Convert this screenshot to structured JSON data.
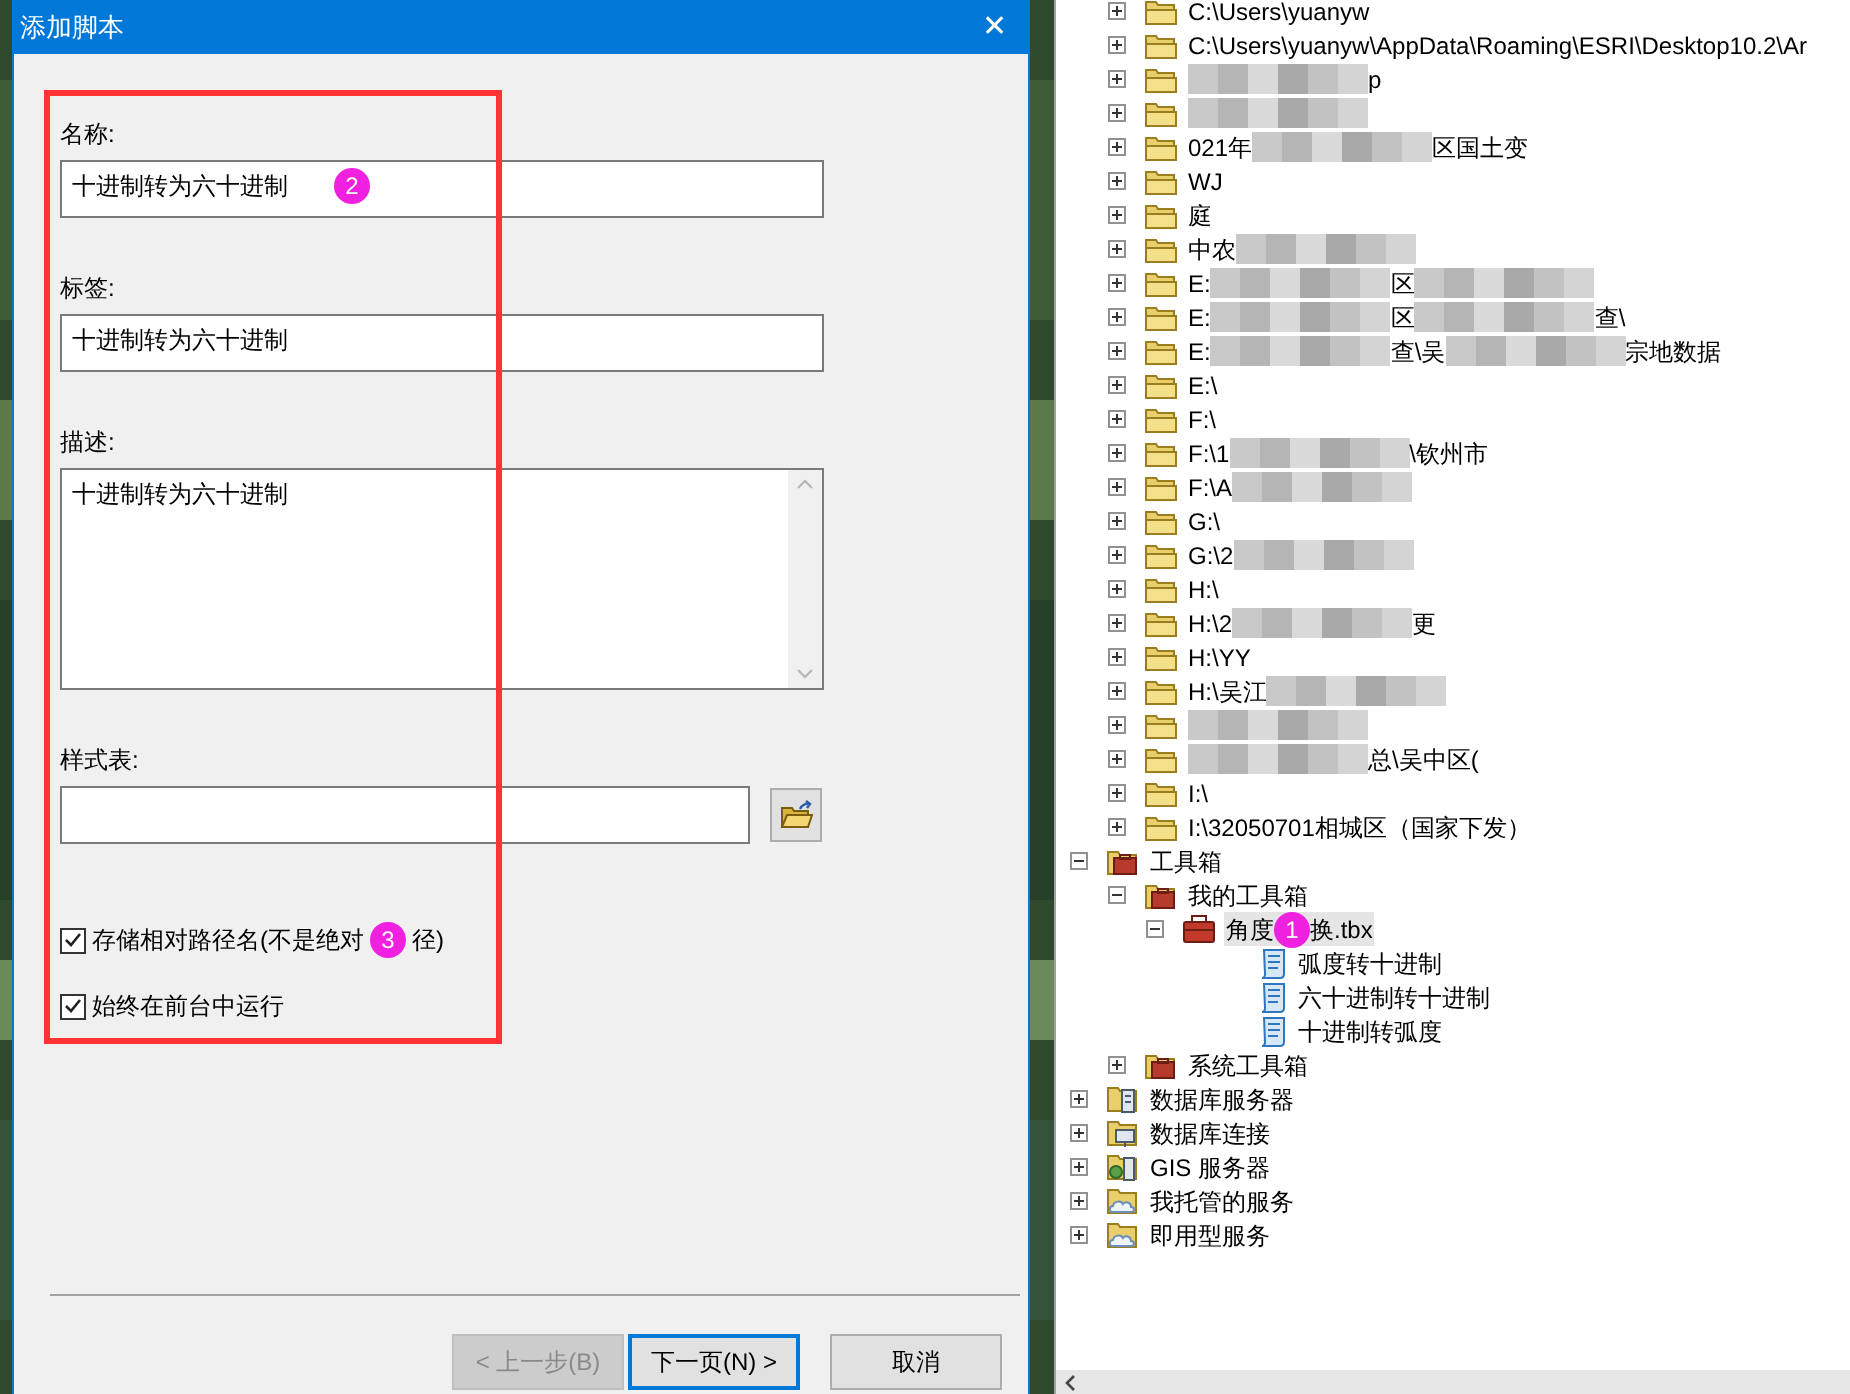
{
  "dialog": {
    "title": "添加脚本",
    "close": "✕",
    "fields": [
      {
        "label": "名称:",
        "value": "十进制转为六十进制",
        "kind": "text"
      },
      {
        "label": "标签:",
        "value": "十进制转为六十进制",
        "kind": "text"
      },
      {
        "label": "描述:",
        "value": "十进制转为六十进制",
        "kind": "multiline"
      },
      {
        "label": "样式表:",
        "kind": "browse"
      }
    ],
    "checkboxes": [
      {
        "segments": [
          {
            "kind": "text",
            "text": "存储相对路径名(不是绝对"
          },
          {
            "kind": "badge",
            "text": "3"
          },
          {
            "kind": "text",
            "text": "径)"
          }
        ],
        "checked": true
      },
      {
        "segments": [
          {
            "kind": "text",
            "text": "始终在前台中运行"
          }
        ],
        "checked": true
      }
    ],
    "buttons": [
      {
        "label": "< 上一步(B)",
        "disabled": true,
        "default": false
      },
      {
        "label": "下一页(N) >",
        "disabled": false,
        "default": true
      },
      {
        "label": "取消",
        "disabled": false,
        "default": false
      }
    ],
    "badge": "2"
  },
  "folder_connections": [
    {
      "segments": [
        {
          "kind": "text",
          "text": "C:\\Users\\yuanyw"
        }
      ]
    },
    {
      "segments": [
        {
          "kind": "text",
          "text": "C:\\Users\\yuanyw\\AppData\\Roaming\\ESRI\\Desktop10.2\\Ar"
        }
      ]
    },
    {
      "segments": [
        {
          "kind": "mosaic"
        },
        {
          "kind": "text",
          "text": "p"
        }
      ]
    },
    {
      "segments": [
        {
          "kind": "mosaic"
        }
      ]
    },
    {
      "segments": [
        {
          "kind": "text",
          "text": "021年"
        },
        {
          "kind": "mosaic"
        },
        {
          "kind": "text",
          "text": "区国土变"
        }
      ]
    },
    {
      "segments": [
        {
          "kind": "text",
          "text": "WJ"
        }
      ]
    },
    {
      "segments": [
        {
          "kind": "text",
          "text": "庭"
        }
      ]
    },
    {
      "segments": [
        {
          "kind": "text",
          "text": "中农"
        },
        {
          "kind": "mosaic"
        }
      ]
    },
    {
      "segments": [
        {
          "kind": "text",
          "text": "E:"
        },
        {
          "kind": "mosaic"
        },
        {
          "kind": "text",
          "text": "区"
        },
        {
          "kind": "mosaic"
        }
      ]
    },
    {
      "segments": [
        {
          "kind": "text",
          "text": "E:"
        },
        {
          "kind": "mosaic"
        },
        {
          "kind": "text",
          "text": "区"
        },
        {
          "kind": "mosaic"
        },
        {
          "kind": "text",
          "text": "查\\"
        }
      ]
    },
    {
      "segments": [
        {
          "kind": "text",
          "text": "E:"
        },
        {
          "kind": "mosaic"
        },
        {
          "kind": "text",
          "text": "查\\吴"
        },
        {
          "kind": "mosaic"
        },
        {
          "kind": "text",
          "text": "宗地数据"
        }
      ]
    },
    {
      "segments": [
        {
          "kind": "text",
          "text": "E:\\"
        }
      ]
    },
    {
      "segments": [
        {
          "kind": "text",
          "text": "F:\\"
        }
      ]
    },
    {
      "segments": [
        {
          "kind": "text",
          "text": "F:\\1"
        },
        {
          "kind": "mosaic"
        },
        {
          "kind": "text",
          "text": "\\钦州市"
        }
      ]
    },
    {
      "segments": [
        {
          "kind": "text",
          "text": "F:\\A"
        },
        {
          "kind": "mosaic"
        }
      ]
    },
    {
      "segments": [
        {
          "kind": "text",
          "text": "G:\\"
        }
      ]
    },
    {
      "segments": [
        {
          "kind": "text",
          "text": "G:\\2"
        },
        {
          "kind": "mosaic"
        }
      ]
    },
    {
      "segments": [
        {
          "kind": "text",
          "text": "H:\\"
        }
      ]
    },
    {
      "segments": [
        {
          "kind": "text",
          "text": "H:\\2"
        },
        {
          "kind": "mosaic"
        },
        {
          "kind": "text",
          "text": "更"
        }
      ]
    },
    {
      "segments": [
        {
          "kind": "text",
          "text": "H:\\YY"
        }
      ]
    },
    {
      "segments": [
        {
          "kind": "text",
          "text": "H:\\吴江"
        },
        {
          "kind": "mosaic"
        }
      ]
    },
    {
      "segments": [
        {
          "kind": "mosaic"
        }
      ]
    },
    {
      "segments": [
        {
          "kind": "mosaic"
        },
        {
          "kind": "text",
          "text": "总\\吴中区("
        }
      ]
    },
    {
      "segments": [
        {
          "kind": "text",
          "text": "I:\\"
        }
      ]
    },
    {
      "segments": [
        {
          "kind": "text",
          "text": "I:\\32050701相城区（国家下发）"
        }
      ]
    }
  ],
  "catalog": [
    {
      "kind": "toolbox-folder",
      "segments": [
        {
          "kind": "text",
          "text": "工具箱"
        }
      ],
      "expanded": true,
      "selected": false,
      "children": [
        {
          "kind": "toolbox-folder",
          "segments": [
            {
              "kind": "text",
              "text": "我的工具箱"
            }
          ],
          "expanded": true,
          "selected": false,
          "children": [
            {
              "kind": "toolbox",
              "segments": [
                {
                  "kind": "text",
                  "text": "角度"
                },
                {
                  "kind": "badge",
                  "text": "1"
                },
                {
                  "kind": "text",
                  "text": "换.tbx"
                }
              ],
              "expanded": true,
              "selected": true,
              "children": [
                {
                  "kind": "script",
                  "segments": [
                    {
                      "kind": "text",
                      "text": "弧度转十进制"
                    }
                  ],
                  "selected": false
                },
                {
                  "kind": "script",
                  "segments": [
                    {
                      "kind": "text",
                      "text": "六十进制转十进制"
                    }
                  ],
                  "selected": false
                },
                {
                  "kind": "script",
                  "segments": [
                    {
                      "kind": "text",
                      "text": "十进制转弧度"
                    }
                  ],
                  "selected": false
                }
              ]
            }
          ]
        },
        {
          "kind": "toolbox-folder",
          "segments": [
            {
              "kind": "text",
              "text": "系统工具箱"
            }
          ],
          "expanded": false,
          "selected": false
        }
      ]
    },
    {
      "kind": "db-server",
      "segments": [
        {
          "kind": "text",
          "text": "数据库服务器"
        }
      ],
      "expanded": false,
      "selected": false
    },
    {
      "kind": "db-connection",
      "segments": [
        {
          "kind": "text",
          "text": "数据库连接"
        }
      ],
      "expanded": false,
      "selected": false
    },
    {
      "kind": "gis-server",
      "segments": [
        {
          "kind": "text",
          "text": "GIS 服务器"
        }
      ],
      "expanded": false,
      "selected": false
    },
    {
      "kind": "cloud-folder",
      "segments": [
        {
          "kind": "text",
          "text": "我托管的服务"
        }
      ],
      "expanded": false,
      "selected": false
    },
    {
      "kind": "cloud-folder",
      "segments": [
        {
          "kind": "text",
          "text": "即用型服务"
        }
      ],
      "expanded": false,
      "selected": false
    }
  ]
}
